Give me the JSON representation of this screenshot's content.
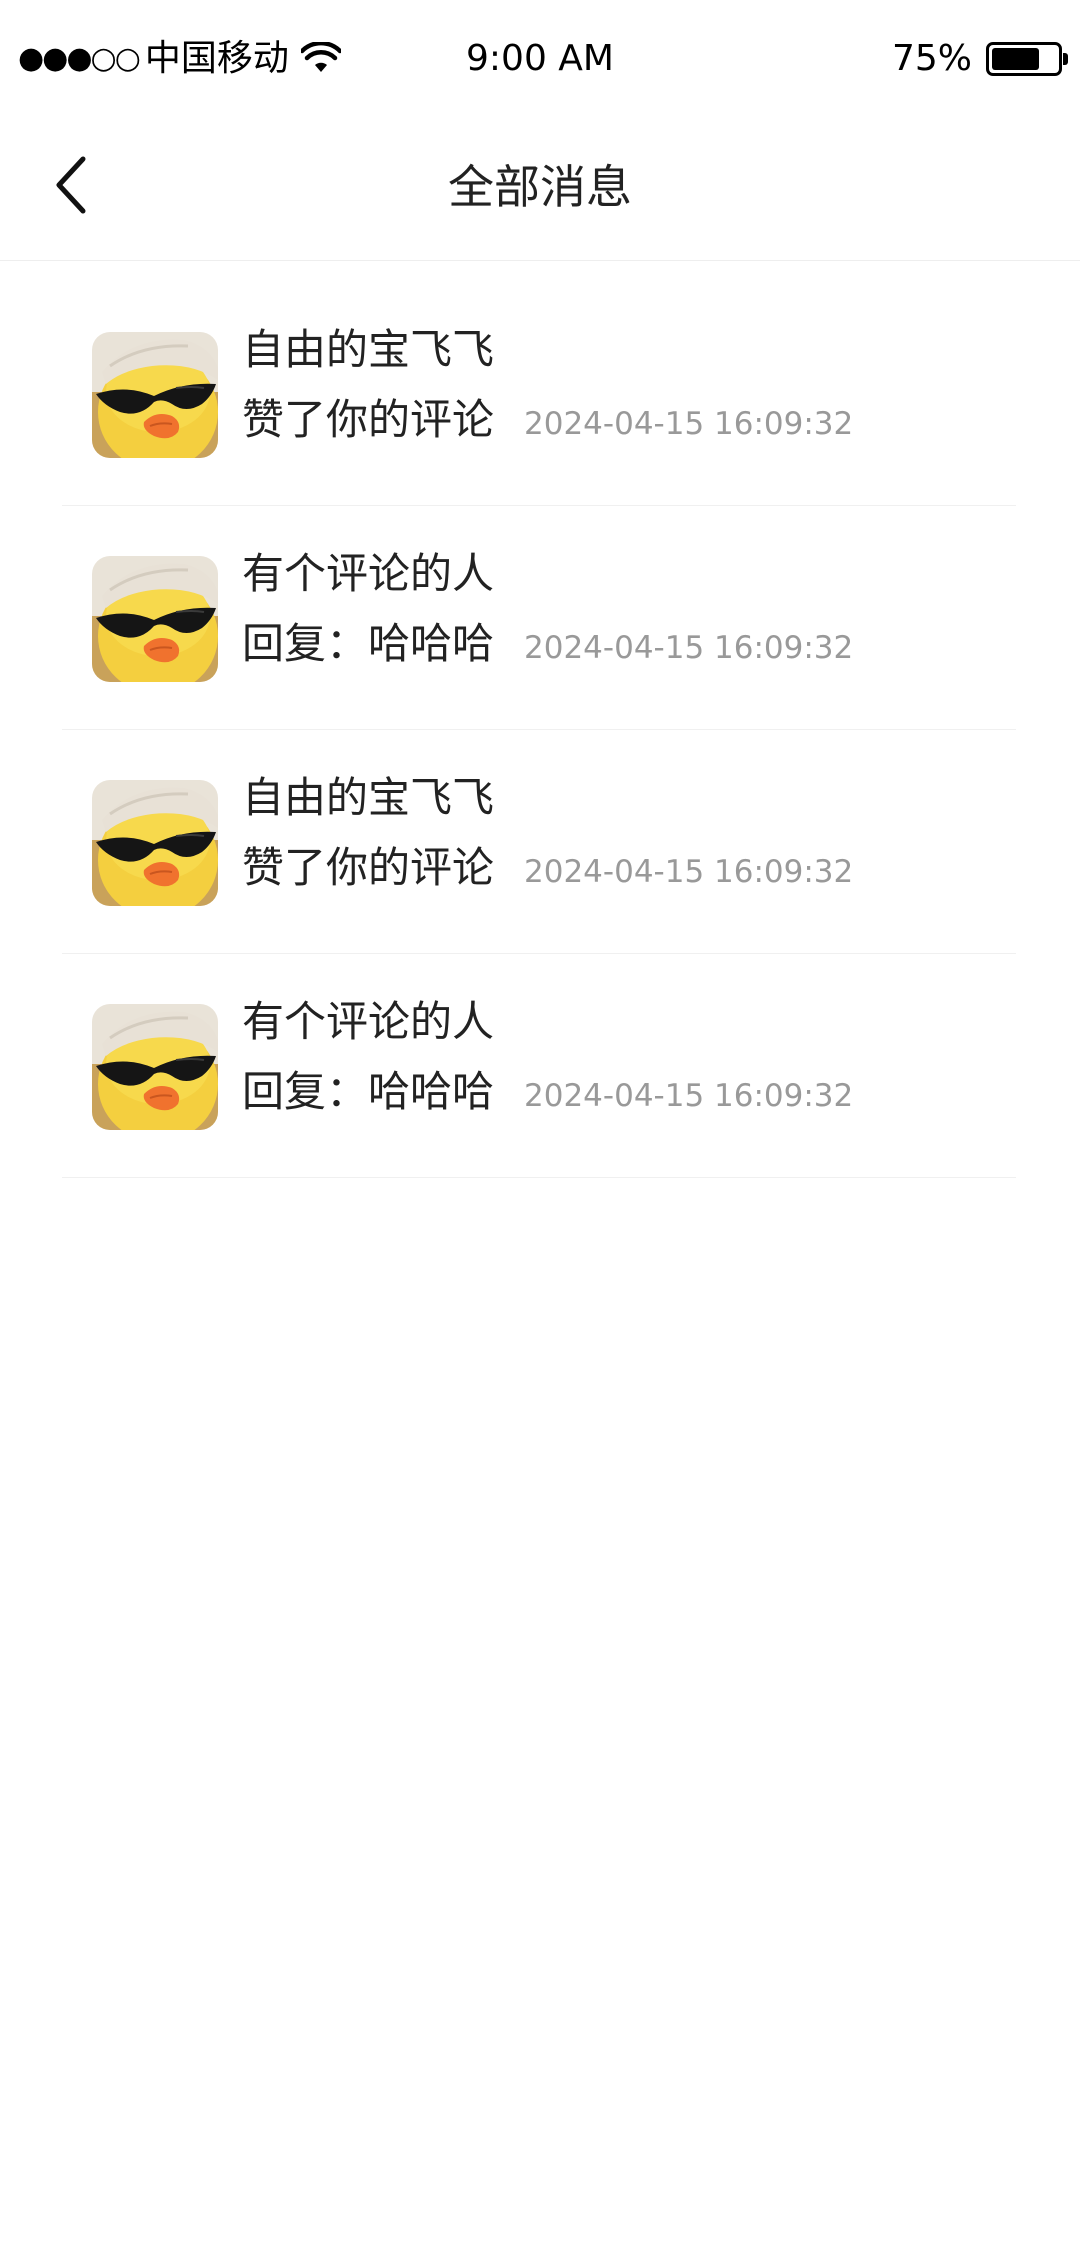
{
  "status_bar": {
    "signal": "●●●○○",
    "carrier": "中国移动",
    "time": "9:00 AM",
    "battery_percent": "75%",
    "battery_level": 0.75,
    "wifi_icon": "wifi-icon"
  },
  "nav": {
    "back_icon": "chevron-left-icon",
    "title": "全部消息"
  },
  "messages": [
    {
      "name": "自由的宝飞飞",
      "action": "赞了你的评论",
      "time": "2024-04-15  16:09:32",
      "avatar": "duck-sunglasses-avatar"
    },
    {
      "name": "有个评论的人",
      "action": "回复：哈哈哈",
      "time": "2024-04-15  16:09:32",
      "avatar": "duck-sunglasses-avatar"
    },
    {
      "name": "自由的宝飞飞",
      "action": "赞了你的评论",
      "time": "2024-04-15  16:09:32",
      "avatar": "duck-sunglasses-avatar"
    },
    {
      "name": "有个评论的人",
      "action": "回复：哈哈哈",
      "time": "2024-04-15  16:09:32",
      "avatar": "duck-sunglasses-avatar"
    }
  ],
  "colors": {
    "text_primary": "#222222",
    "text_secondary": "#999999",
    "divider": "#f0f0f0",
    "background": "#ffffff"
  }
}
